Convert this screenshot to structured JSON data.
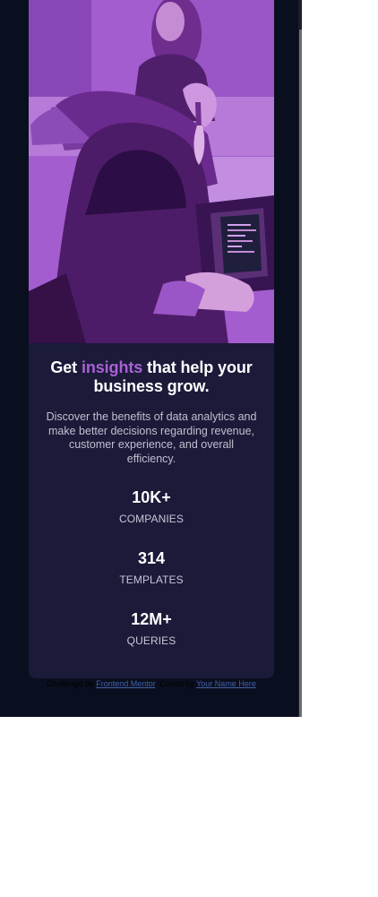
{
  "card": {
    "hero_image_alt": "Two women working on laptops at a table",
    "heading": {
      "prefix": "Get ",
      "highlight": "insights",
      "suffix": " that help your business grow."
    },
    "description": "Discover the benefits of data analytics and make better decisions regarding revenue, customer experience, and overall efficiency.",
    "stats": [
      {
        "value": "10K+",
        "label": "COMPANIES"
      },
      {
        "value": "314",
        "label": "TEMPLATES"
      },
      {
        "value": "12M+",
        "label": "QUERIES"
      }
    ]
  },
  "footer": {
    "challenge_prefix": "Challenge by ",
    "challenge_link": "Frontend Mentor",
    "coded_prefix": ". Coded by ",
    "coded_link": "Your Name Here"
  },
  "colors": {
    "page_background": "#0a0f1f",
    "card_background": "#1b1a39",
    "accent": "#a962d3",
    "link": "#4361a9"
  },
  "icons": {
    "hero": "office-photo-image"
  }
}
